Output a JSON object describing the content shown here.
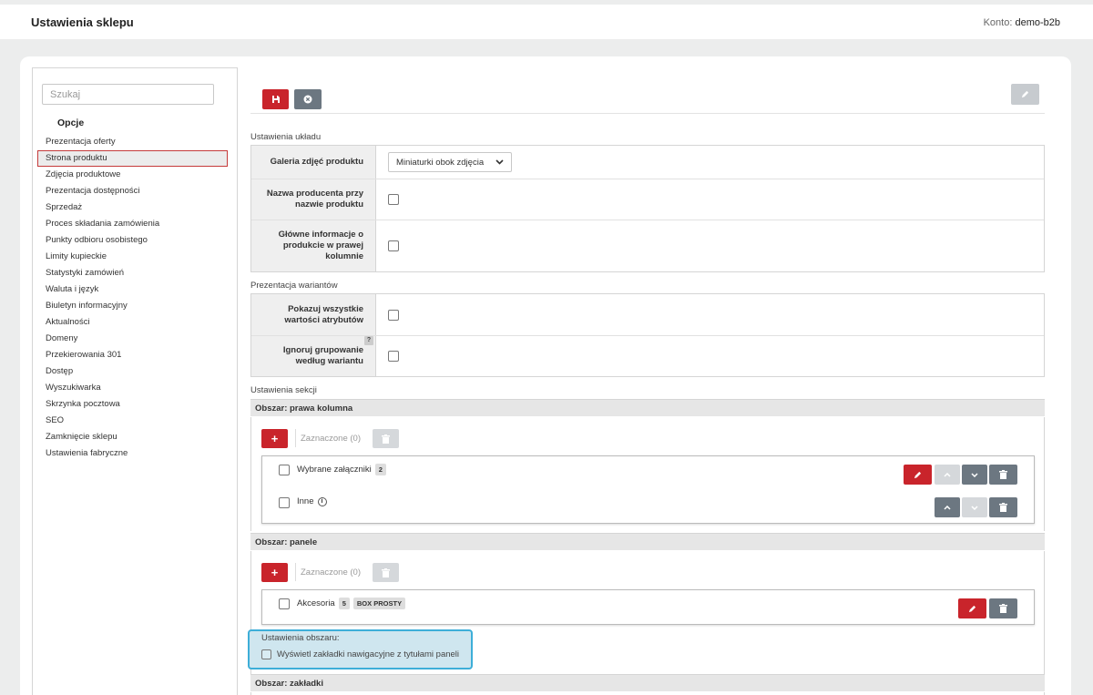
{
  "header": {
    "title": "Ustawienia sklepu",
    "account_label": "Konto:",
    "account_name": "demo-b2b"
  },
  "sidebar": {
    "search_placeholder": "Szukaj",
    "heading": "Opcje",
    "items": [
      {
        "label": "Prezentacja oferty"
      },
      {
        "label": "Strona produktu"
      },
      {
        "label": "Zdjęcia produktowe"
      },
      {
        "label": "Prezentacja dostępności"
      },
      {
        "label": "Sprzedaż"
      },
      {
        "label": "Proces składania zamówienia"
      },
      {
        "label": "Punkty odbioru osobistego"
      },
      {
        "label": "Limity kupieckie"
      },
      {
        "label": "Statystyki zamówień"
      },
      {
        "label": "Waluta i język"
      },
      {
        "label": "Biuletyn informacyjny"
      },
      {
        "label": "Aktualności"
      },
      {
        "label": "Domeny"
      },
      {
        "label": "Przekierowania 301"
      },
      {
        "label": "Dostęp"
      },
      {
        "label": "Wyszukiwarka"
      },
      {
        "label": "Skrzynka pocztowa"
      },
      {
        "label": "SEO"
      },
      {
        "label": "Zamknięcie sklepu"
      },
      {
        "label": "Ustawienia fabryczne"
      }
    ],
    "active_item": "Strona produktu"
  },
  "layout_settings": {
    "title": "Ustawienia układu",
    "gallery": {
      "label": "Galeria zdjęć produktu",
      "value": "Miniaturki obok zdjęcia"
    },
    "manufacturer": {
      "label": "Nazwa producenta przy nazwie produktu"
    },
    "main_info": {
      "label": "Główne informacje o produkcie w prawej kolumnie"
    }
  },
  "variants": {
    "title": "Prezentacja wariantów",
    "show_all": {
      "label": "Pokazuj wszystkie wartości atrybutów"
    },
    "ignore_grouping": {
      "label": "Ignoruj grupowanie według wariantu",
      "help": "?"
    }
  },
  "sections": {
    "title": "Ustawienia sekcji",
    "right_column": {
      "header": "Obszar: prawa kolumna",
      "selected": "Zaznaczone (0)",
      "items": [
        {
          "label": "Wybrane załączniki",
          "count": "2"
        },
        {
          "label": "Inne"
        }
      ]
    },
    "panels": {
      "header": "Obszar: panele",
      "selected": "Zaznaczone (0)",
      "items": [
        {
          "label": "Akcesoria",
          "count": "5",
          "tag": "BOX PROSTY"
        }
      ],
      "area_settings_title": "Ustawienia obszaru:",
      "area_settings_option": "Wyświetl zakładki nawigacyjne z tytułami paneli"
    },
    "tabs": {
      "header": "Obszar: zakładki"
    }
  },
  "icons": {
    "save": "save-icon",
    "cancel": "cancel-icon",
    "edit": "pencil-icon",
    "add": "plus-icon",
    "delete": "trash-icon",
    "up": "chevron-up-icon",
    "down": "chevron-down-icon",
    "info": "info-icon"
  },
  "colors": {
    "primary": "#c9242b",
    "secondary": "#6c7781",
    "highlight": "#3daed8"
  },
  "add_label": "+"
}
